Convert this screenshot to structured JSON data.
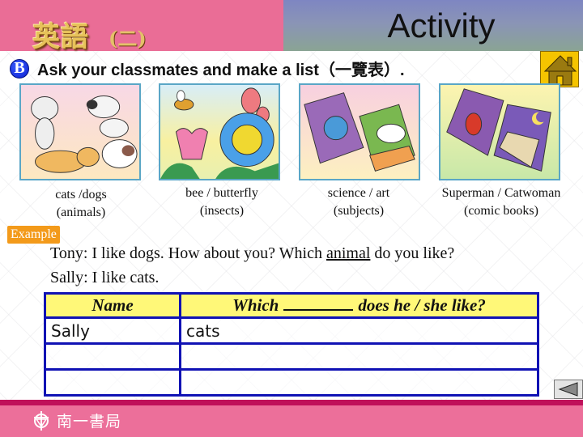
{
  "header": {
    "course_title": "英語",
    "course_volume": "(二)",
    "activity_title": "Activity"
  },
  "instruction": {
    "badge": "B",
    "text": "Ask your classmates and make a list（一覽表）."
  },
  "home_button": {
    "icon": "home-icon"
  },
  "pictures": [
    {
      "name": "animals",
      "line1": "cats /dogs",
      "line2": "(animals)"
    },
    {
      "name": "insects",
      "line1": "bee / butterfly",
      "line2": "(insects)"
    },
    {
      "name": "subjects",
      "line1": "science / art",
      "line2": "(subjects)"
    },
    {
      "name": "comic-books",
      "line1": "Superman / Catwoman",
      "line2": "(comic books)"
    }
  ],
  "example": {
    "tag": "Example",
    "line1_pre": "Tony: I like dogs. How about you?  Which ",
    "line1_underlined": "animal",
    "line1_post": " do you like?",
    "line2": "Sally: I like cats."
  },
  "table": {
    "header_name": "Name",
    "header_which_pre": "Which",
    "header_which_post": "does he / she like?",
    "rows": [
      {
        "name": "Sally",
        "answer": "cats"
      },
      {
        "name": "",
        "answer": ""
      },
      {
        "name": "",
        "answer": ""
      }
    ]
  },
  "back_button": {
    "icon": "triangle-left-icon"
  },
  "footer": {
    "publisher": "南一書局"
  },
  "colors": {
    "header_pink": "#ea6d96",
    "table_border": "#1012b4",
    "table_header_bg": "#fff878",
    "example_orange": "#f39a1a",
    "home_yellow": "#f5c400",
    "footer_pink": "#ec6f9a"
  }
}
